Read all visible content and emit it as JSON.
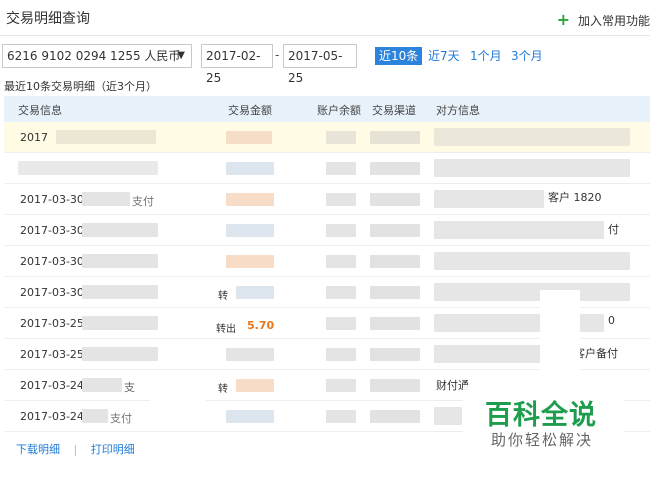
{
  "header": {
    "title": "交易明细查询",
    "add_favorite": "加入常用功能"
  },
  "filters": {
    "account": "6216 9102 0294 1255 人民币",
    "date_from": "2017-02-25",
    "date_to": "2017-05-25",
    "date_separator": "-",
    "quick_ranges": [
      "近10条",
      "近7天",
      "1个月",
      "3个月"
    ],
    "active_range": "近10条"
  },
  "table": {
    "subtitle": "最近10条交易明细（近3个月）",
    "columns": [
      "交易信息",
      "交易金额",
      "账户余额",
      "交易渠道",
      "对方信息"
    ],
    "rows": [
      {
        "date": "2017",
        "amount_tag": "",
        "amount": "",
        "counterparty": "",
        "highlighted": true
      },
      {
        "date": "",
        "amount_tag": "",
        "amount": "",
        "counterparty": ""
      },
      {
        "date": "2017-03-30",
        "detail_fragment": "支付",
        "amount_tag": "",
        "amount": "",
        "counterparty": "客户 1820"
      },
      {
        "date": "2017-03-30",
        "amount_tag": "",
        "amount": "",
        "counterparty": "付"
      },
      {
        "date": "2017-03-30",
        "amount_tag": "",
        "amount": "",
        "counterparty": ""
      },
      {
        "date": "2017-03-30",
        "amount_tag": "转",
        "amount": "",
        "counterparty": ""
      },
      {
        "date": "2017-03-25",
        "amount_tag": "转出",
        "amount": "5.70",
        "counterparty": "0"
      },
      {
        "date": "2017-03-25",
        "amount_tag": "",
        "amount": "",
        "counterparty": "客户备付"
      },
      {
        "date": "2017-03-24",
        "detail_fragment": "支",
        "amount_tag": "转",
        "amount": "",
        "counterparty": "财付通"
      },
      {
        "date": "2017-03-24",
        "detail_fragment": "支付",
        "amount_tag": "",
        "amount": "",
        "counterparty": ""
      }
    ]
  },
  "footer": {
    "download": "下载明细",
    "separator": "|",
    "print": "打印明细"
  },
  "watermark": {
    "logo": "百科全说",
    "tagline": "助你轻松解决"
  },
  "colors": {
    "accent_blue": "#2b83db",
    "link_blue": "#1f7ad8",
    "amount_orange": "#e8761b",
    "header_bg": "#e8f2fb",
    "highlight_row": "#fffbe5",
    "brand_green": "#1f9d4f"
  }
}
